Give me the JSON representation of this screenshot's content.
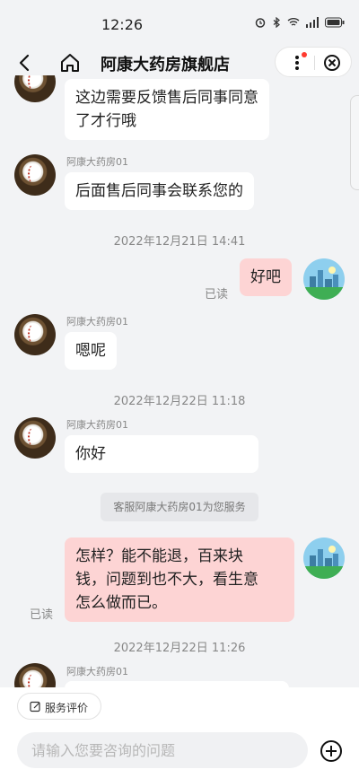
{
  "status_bar": {
    "time": "12:26",
    "icons": [
      "alarm-icon",
      "bluetooth-icon",
      "wifi-icon",
      "signal-icon",
      "battery-icon"
    ]
  },
  "header": {
    "title": "阿康大药房旗舰店",
    "icons": [
      "back-icon",
      "home-icon",
      "more-icon",
      "close-circle-icon"
    ]
  },
  "chat": {
    "m1": {
      "line1": "这边需要反馈售后同事同意",
      "line2": "了才行哦"
    },
    "m2": {
      "name": "阿康大药房01",
      "text": "后面售后同事会联系您的"
    },
    "ts1": "2022年12月21日 14:41",
    "m3": {
      "text": "好吧",
      "read": "已读"
    },
    "m4": {
      "name": "阿康大药房01",
      "text": "嗯呢"
    },
    "ts2": "2022年12月22日 11:18",
    "m5": {
      "name": "阿康大药房01",
      "text": "你好"
    },
    "system": "客服阿康大药房01为您服务",
    "m6": {
      "line1": "怎样？能不能退，百来块",
      "line2": "钱，问题到也不大，看生意",
      "line3": "怎么做而已。",
      "read": "已读"
    },
    "ts3": "2022年12月22日 11:26",
    "m7": {
      "name": "阿康大药房01"
    }
  },
  "bottom": {
    "rate_label": "服务评价",
    "input_placeholder": "请输入您要咨询的问题"
  },
  "colors": {
    "page_bg": "#f2f3f5",
    "my_bubble": "#fdd4d4",
    "their_bubble": "#ffffff",
    "dot": "#ff3b30"
  }
}
